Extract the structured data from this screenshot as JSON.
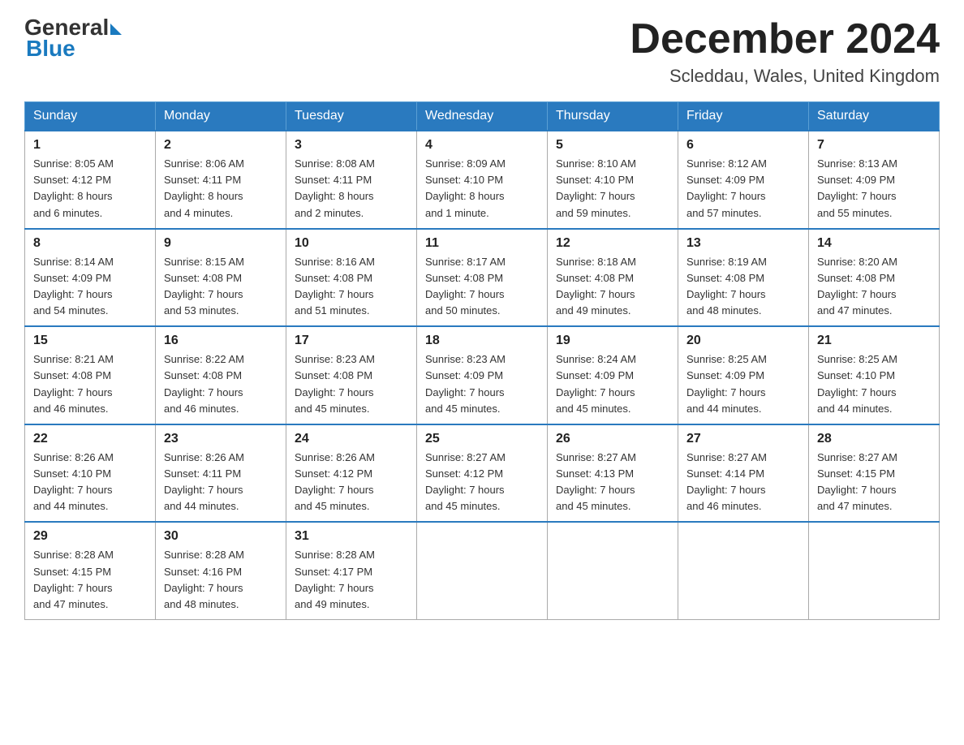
{
  "header": {
    "logo_text_general": "General",
    "logo_text_blue": "Blue",
    "month_title": "December 2024",
    "location": "Scleddau, Wales, United Kingdom"
  },
  "calendar": {
    "days_of_week": [
      "Sunday",
      "Monday",
      "Tuesday",
      "Wednesday",
      "Thursday",
      "Friday",
      "Saturday"
    ],
    "weeks": [
      [
        {
          "day": "1",
          "sunrise": "8:05 AM",
          "sunset": "4:12 PM",
          "daylight": "8 hours and 6 minutes."
        },
        {
          "day": "2",
          "sunrise": "8:06 AM",
          "sunset": "4:11 PM",
          "daylight": "8 hours and 4 minutes."
        },
        {
          "day": "3",
          "sunrise": "8:08 AM",
          "sunset": "4:11 PM",
          "daylight": "8 hours and 2 minutes."
        },
        {
          "day": "4",
          "sunrise": "8:09 AM",
          "sunset": "4:10 PM",
          "daylight": "8 hours and 1 minute."
        },
        {
          "day": "5",
          "sunrise": "8:10 AM",
          "sunset": "4:10 PM",
          "daylight": "7 hours and 59 minutes."
        },
        {
          "day": "6",
          "sunrise": "8:12 AM",
          "sunset": "4:09 PM",
          "daylight": "7 hours and 57 minutes."
        },
        {
          "day": "7",
          "sunrise": "8:13 AM",
          "sunset": "4:09 PM",
          "daylight": "7 hours and 55 minutes."
        }
      ],
      [
        {
          "day": "8",
          "sunrise": "8:14 AM",
          "sunset": "4:09 PM",
          "daylight": "7 hours and 54 minutes."
        },
        {
          "day": "9",
          "sunrise": "8:15 AM",
          "sunset": "4:08 PM",
          "daylight": "7 hours and 53 minutes."
        },
        {
          "day": "10",
          "sunrise": "8:16 AM",
          "sunset": "4:08 PM",
          "daylight": "7 hours and 51 minutes."
        },
        {
          "day": "11",
          "sunrise": "8:17 AM",
          "sunset": "4:08 PM",
          "daylight": "7 hours and 50 minutes."
        },
        {
          "day": "12",
          "sunrise": "8:18 AM",
          "sunset": "4:08 PM",
          "daylight": "7 hours and 49 minutes."
        },
        {
          "day": "13",
          "sunrise": "8:19 AM",
          "sunset": "4:08 PM",
          "daylight": "7 hours and 48 minutes."
        },
        {
          "day": "14",
          "sunrise": "8:20 AM",
          "sunset": "4:08 PM",
          "daylight": "7 hours and 47 minutes."
        }
      ],
      [
        {
          "day": "15",
          "sunrise": "8:21 AM",
          "sunset": "4:08 PM",
          "daylight": "7 hours and 46 minutes."
        },
        {
          "day": "16",
          "sunrise": "8:22 AM",
          "sunset": "4:08 PM",
          "daylight": "7 hours and 46 minutes."
        },
        {
          "day": "17",
          "sunrise": "8:23 AM",
          "sunset": "4:08 PM",
          "daylight": "7 hours and 45 minutes."
        },
        {
          "day": "18",
          "sunrise": "8:23 AM",
          "sunset": "4:09 PM",
          "daylight": "7 hours and 45 minutes."
        },
        {
          "day": "19",
          "sunrise": "8:24 AM",
          "sunset": "4:09 PM",
          "daylight": "7 hours and 45 minutes."
        },
        {
          "day": "20",
          "sunrise": "8:25 AM",
          "sunset": "4:09 PM",
          "daylight": "7 hours and 44 minutes."
        },
        {
          "day": "21",
          "sunrise": "8:25 AM",
          "sunset": "4:10 PM",
          "daylight": "7 hours and 44 minutes."
        }
      ],
      [
        {
          "day": "22",
          "sunrise": "8:26 AM",
          "sunset": "4:10 PM",
          "daylight": "7 hours and 44 minutes."
        },
        {
          "day": "23",
          "sunrise": "8:26 AM",
          "sunset": "4:11 PM",
          "daylight": "7 hours and 44 minutes."
        },
        {
          "day": "24",
          "sunrise": "8:26 AM",
          "sunset": "4:12 PM",
          "daylight": "7 hours and 45 minutes."
        },
        {
          "day": "25",
          "sunrise": "8:27 AM",
          "sunset": "4:12 PM",
          "daylight": "7 hours and 45 minutes."
        },
        {
          "day": "26",
          "sunrise": "8:27 AM",
          "sunset": "4:13 PM",
          "daylight": "7 hours and 45 minutes."
        },
        {
          "day": "27",
          "sunrise": "8:27 AM",
          "sunset": "4:14 PM",
          "daylight": "7 hours and 46 minutes."
        },
        {
          "day": "28",
          "sunrise": "8:27 AM",
          "sunset": "4:15 PM",
          "daylight": "7 hours and 47 minutes."
        }
      ],
      [
        {
          "day": "29",
          "sunrise": "8:28 AM",
          "sunset": "4:15 PM",
          "daylight": "7 hours and 47 minutes."
        },
        {
          "day": "30",
          "sunrise": "8:28 AM",
          "sunset": "4:16 PM",
          "daylight": "7 hours and 48 minutes."
        },
        {
          "day": "31",
          "sunrise": "8:28 AM",
          "sunset": "4:17 PM",
          "daylight": "7 hours and 49 minutes."
        },
        null,
        null,
        null,
        null
      ]
    ],
    "labels": {
      "sunrise": "Sunrise:",
      "sunset": "Sunset:",
      "daylight": "Daylight:"
    }
  }
}
